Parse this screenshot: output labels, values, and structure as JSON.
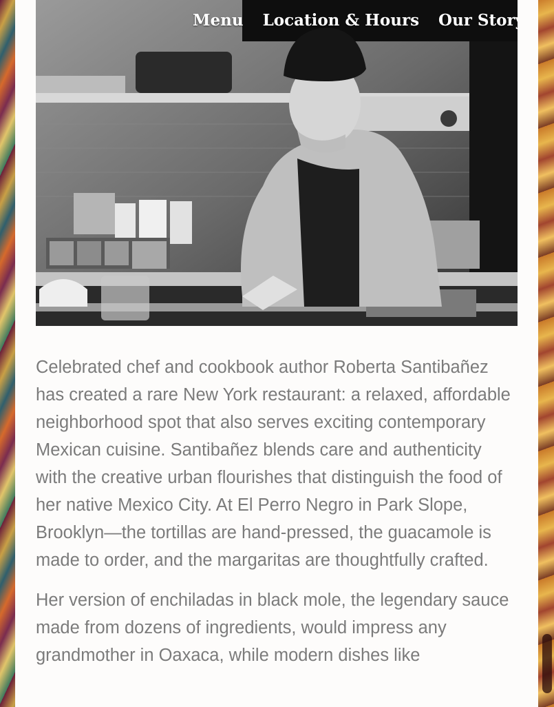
{
  "nav": {
    "items": [
      "Menu",
      "Location & Hours",
      "Our Story"
    ]
  },
  "hero": {
    "alt": "Chef working in kitchen"
  },
  "content": {
    "paragraphs": [
      "Celebrated chef and cookbook author Roberta Santibañez has created a rare New York restaurant: a relaxed, affordable neighborhood spot that also serves exciting contemporary Mexican cuisine. Santibañez blends care and authenticity with the creative urban flourishes that distinguish the food of her native Mexico City. At El Perro Negro in Park Slope, Brooklyn—the tortillas are hand-pressed, the guacamole is made to order, and the margaritas are thoughtfully crafted.",
      "Her version of enchiladas in black mole, the legendary sauce made from dozens of ingredients, would impress any grandmother in Oaxaca, while modern dishes like"
    ]
  }
}
